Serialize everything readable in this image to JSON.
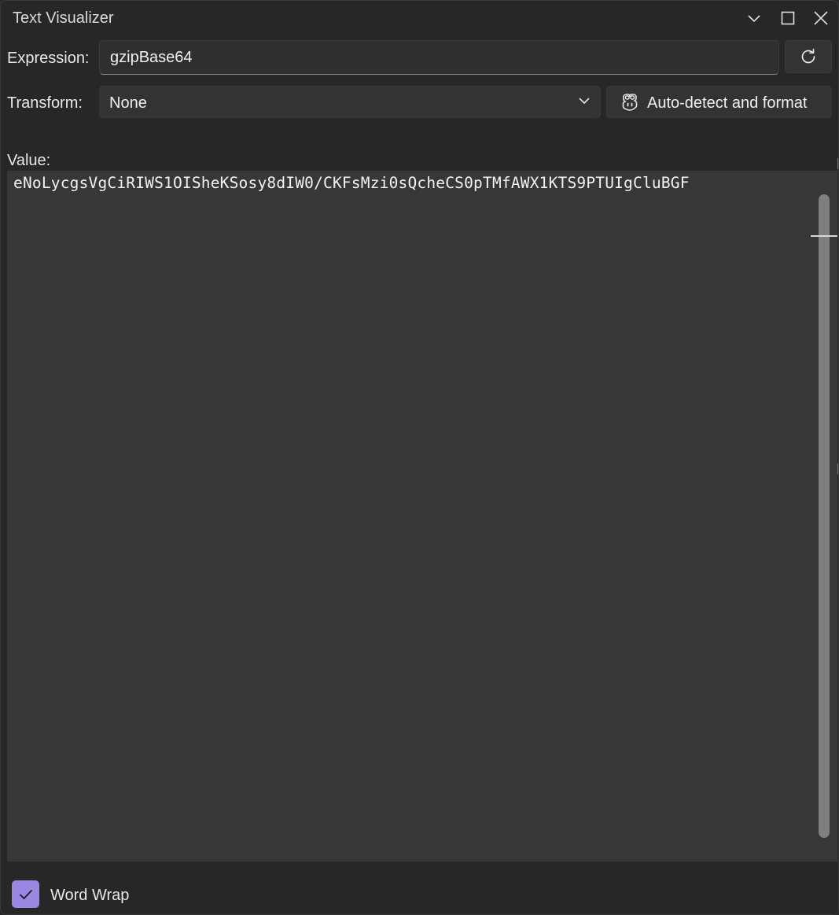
{
  "window": {
    "title": "Text Visualizer"
  },
  "expression": {
    "label": "Expression:",
    "value": "gzipBase64"
  },
  "transform": {
    "label": "Transform:",
    "selected": "None",
    "auto_detect_label": "Auto-detect and format"
  },
  "value": {
    "label": "Value:",
    "text": "eNoLycgsVgCiRIWS1OISheKSosy8dIW0/CKFsMzi0sQcheCS0pTMfAWX1KTS9PTUIgCluBGF"
  },
  "footer": {
    "word_wrap_label": "Word Wrap",
    "word_wrap_checked": true
  },
  "icons": {
    "minimize": "chevron-down-icon",
    "maximize": "maximize-icon",
    "close": "close-icon",
    "refresh": "refresh-icon",
    "dropdown": "chevron-down-icon",
    "auto_detect": "copilot-icon",
    "checkbox": "checkmark-icon"
  },
  "colors": {
    "background": "#272727",
    "surface": "#333333",
    "value_surface": "#373737",
    "accent": "#9b86e3"
  }
}
